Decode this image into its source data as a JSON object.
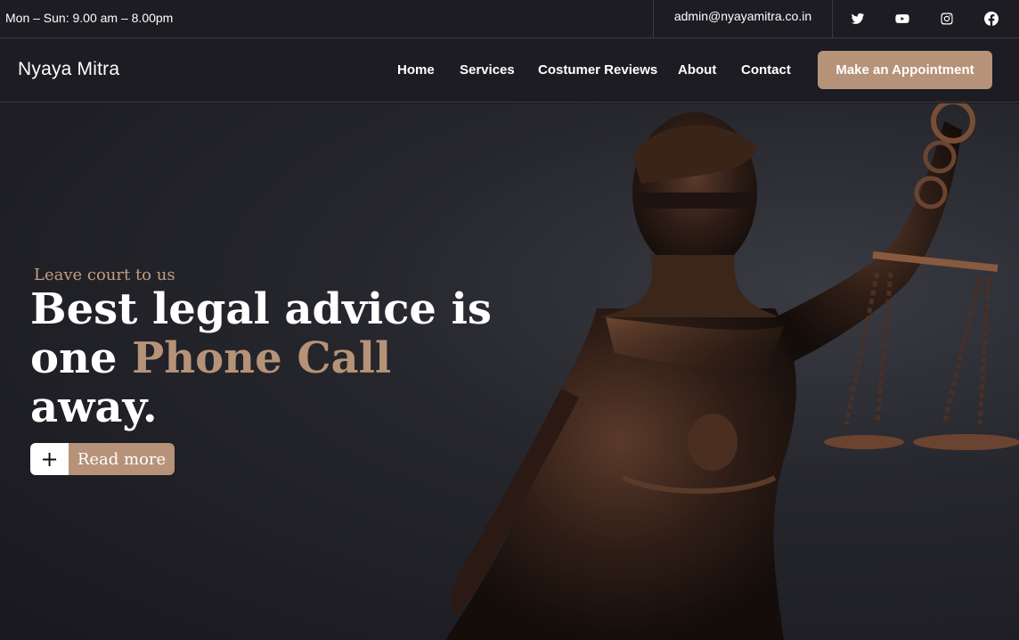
{
  "topbar": {
    "hours": "Mon – Sun: 9.00 am – 8.00pm",
    "email": "admin@nyayamitra.co.in",
    "socials": [
      "twitter-icon",
      "youtube-icon",
      "instagram-icon",
      "facebook-icon"
    ]
  },
  "nav": {
    "brand": "Nyaya Mitra",
    "links": [
      "Home",
      "Services",
      "Costumer Reviews",
      "About",
      "Contact"
    ],
    "cta": "Make an Appointment"
  },
  "hero": {
    "kicker": "Leave court to us",
    "headline_part1": "Best legal advice is one ",
    "headline_accent": "Phone Call",
    "headline_part2": " away.",
    "read_more": "Read more",
    "read_more_icon": "plus-icon"
  },
  "colors": {
    "accent": "#b59278",
    "background": "#1c1c22",
    "divider": "#3a3a42"
  }
}
